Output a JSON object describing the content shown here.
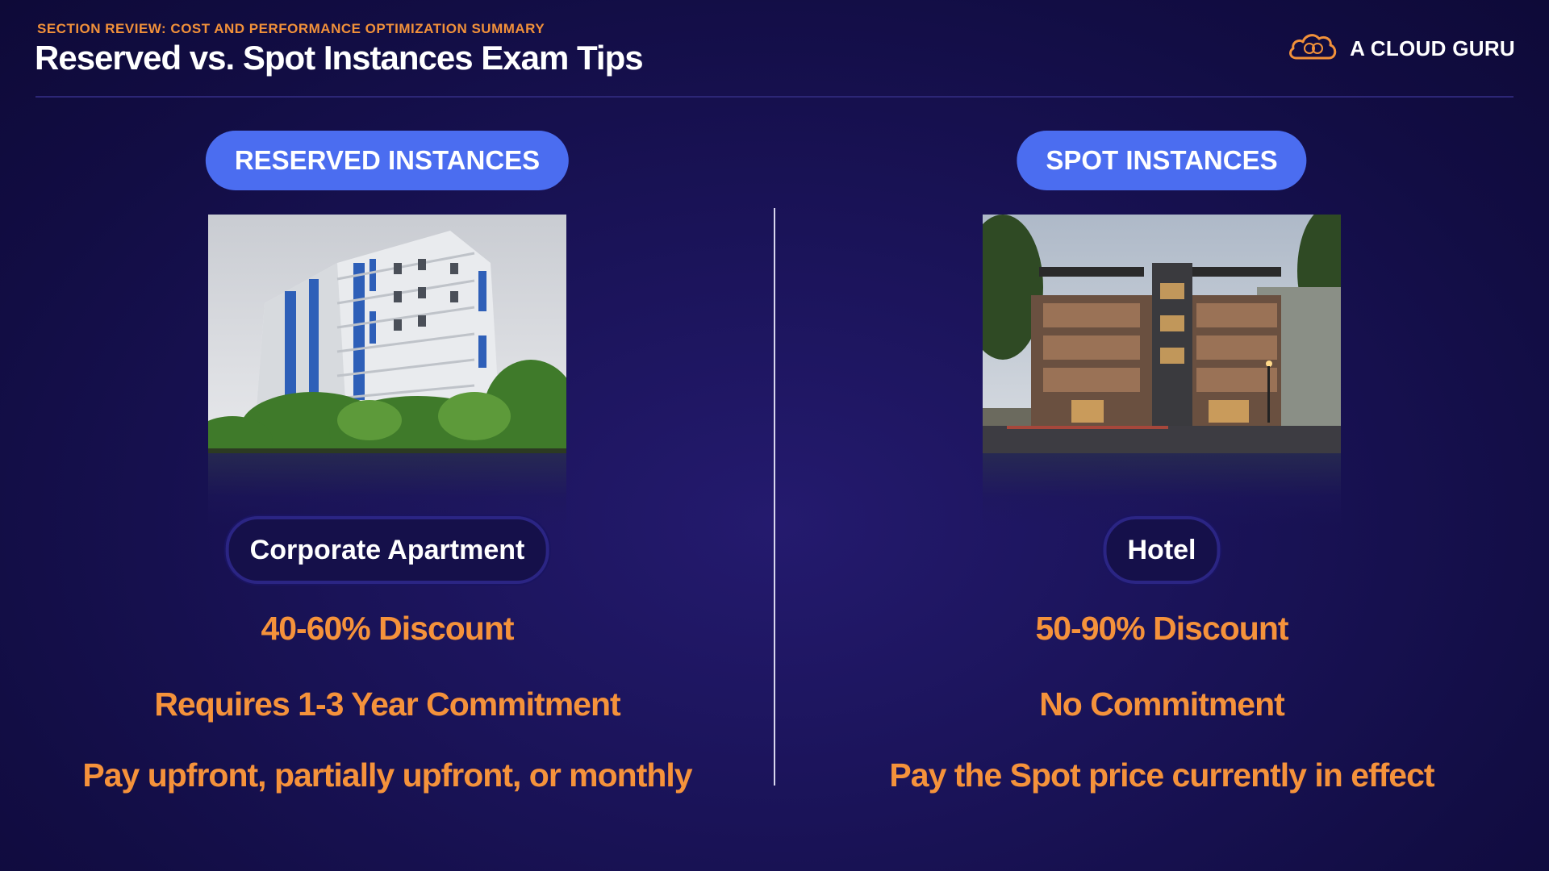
{
  "header": {
    "subtitle": "SECTION REVIEW: COST AND PERFORMANCE OPTIMIZATION SUMMARY",
    "title": "Reserved vs. Spot Instances Exam Tips",
    "logo_text": "A CLOUD GURU",
    "logo_icon": "cloud-icon"
  },
  "colors": {
    "background": "#120d44",
    "accent_orange": "#f5923b",
    "pill_blue": "#4b6df0",
    "text_white": "#ffffff"
  },
  "left": {
    "heading": "RESERVED INSTANCES",
    "image": "apartment-building-photo",
    "label": "Corporate Apartment",
    "discount": "40-60% Discount",
    "commitment": "Requires 1-3 Year Commitment",
    "payment": "Pay upfront, partially upfront, or monthly"
  },
  "right": {
    "heading": "SPOT INSTANCES",
    "image": "hotel-building-photo",
    "label": "Hotel",
    "discount": "50-90% Discount",
    "commitment": "No Commitment",
    "payment": "Pay the Spot price currently in effect"
  }
}
